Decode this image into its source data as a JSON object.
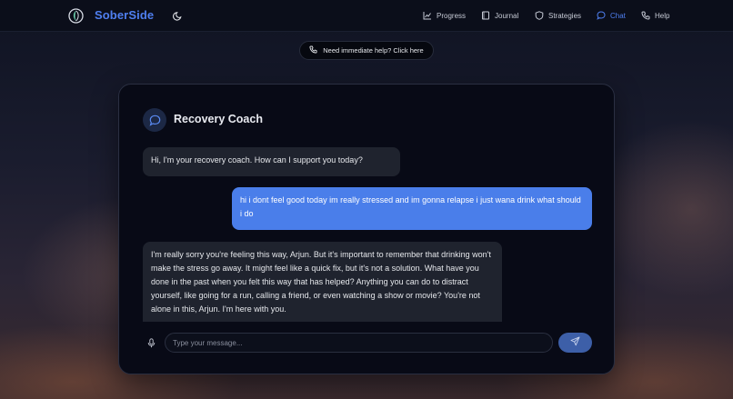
{
  "app": {
    "brand": "SoberSide",
    "logo_icon": "leaf-globe-icon",
    "theme_icon": "moon-icon"
  },
  "nav": {
    "items": [
      {
        "label": "Progress",
        "icon": "chart-icon",
        "active": false
      },
      {
        "label": "Journal",
        "icon": "book-icon",
        "active": false
      },
      {
        "label": "Strategies",
        "icon": "shield-icon",
        "active": false
      },
      {
        "label": "Chat",
        "icon": "chat-icon",
        "active": true
      },
      {
        "label": "Help",
        "icon": "phone-icon",
        "active": false
      }
    ]
  },
  "help_pill": {
    "label": "Need immediate help? Click here",
    "icon": "phone-icon"
  },
  "chat": {
    "title": "Recovery Coach",
    "title_icon": "chat-bubble-icon",
    "messages": [
      {
        "role": "bot",
        "text": "Hi, I'm your recovery coach. How can I support you today?"
      },
      {
        "role": "user",
        "text": "hi i dont feel good today im really stressed and im gonna relapse i just wana drink what should i do"
      },
      {
        "role": "bot",
        "text": "I'm really sorry you're feeling this way, Arjun. But it's important to remember that drinking won't make the stress go away. It might feel like a quick fix, but it's not a solution. What have you done in the past when you felt this way that has helped? Anything you can do to distract yourself, like going for a run, calling a friend, or even watching a show or movie? You're not alone in this, Arjun. I'm here with you."
      }
    ],
    "input": {
      "placeholder": "Type your message...",
      "value": ""
    },
    "mic_icon": "microphone-icon",
    "send_icon": "send-icon"
  },
  "colors": {
    "accent": "#4f7ff0",
    "user_bubble": "#4a7eea",
    "bot_bubble": "#1f232e",
    "card_bg": "#080a16",
    "nav_bg": "#0b0e1a"
  }
}
